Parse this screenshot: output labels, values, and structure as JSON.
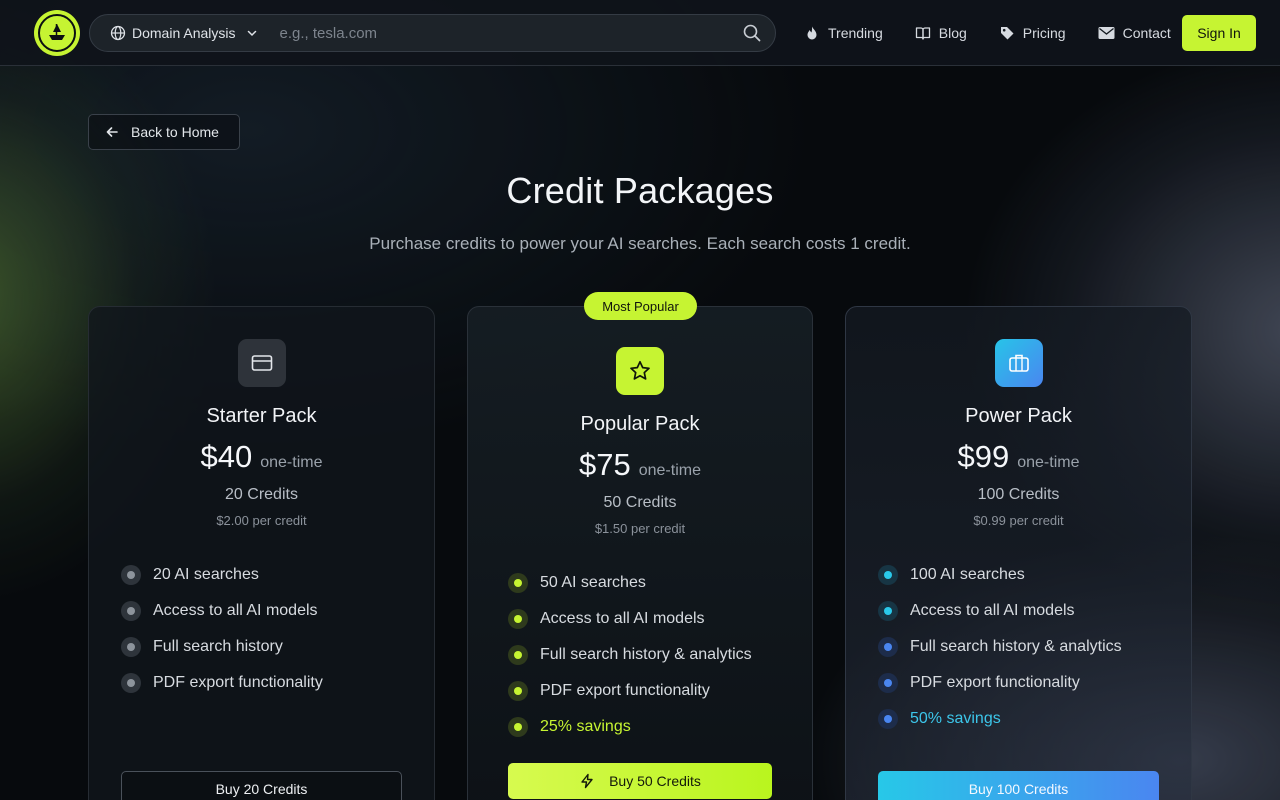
{
  "nav": {
    "search_mode": "Domain Analysis",
    "search_placeholder": "e.g., tesla.com",
    "links": [
      {
        "label": "Trending",
        "icon": "flame-icon"
      },
      {
        "label": "Blog",
        "icon": "book-icon"
      },
      {
        "label": "Pricing",
        "icon": "tag-icon"
      },
      {
        "label": "Contact",
        "icon": "mail-icon"
      }
    ],
    "signin_label": "Sign In"
  },
  "back_label": "Back to Home",
  "title": "Credit Packages",
  "subtitle": "Purchase credits to power your AI searches. Each search costs 1 credit.",
  "cards": [
    {
      "name": "Starter Pack",
      "icon": "credit-card-icon",
      "price": "$40",
      "price_note": "one-time",
      "credits": "20 Credits",
      "per_credit": "$2.00 per credit",
      "features": [
        "20 AI searches",
        "Access to all AI models",
        "Full search history",
        "PDF export functionality"
      ],
      "button": "Buy 20 Credits"
    },
    {
      "name": "Popular Pack",
      "badge": "Most Popular",
      "icon": "star-icon",
      "price": "$75",
      "price_note": "one-time",
      "credits": "50 Credits",
      "per_credit": "$1.50 per credit",
      "features": [
        "50 AI searches",
        "Access to all AI models",
        "Full search history & analytics",
        "PDF export functionality",
        "25% savings"
      ],
      "button": "Buy 50 Credits"
    },
    {
      "name": "Power Pack",
      "icon": "briefcase-icon",
      "price": "$99",
      "price_note": "one-time",
      "credits": "100 Credits",
      "per_credit": "$0.99 per credit",
      "features": [
        "100 AI searches",
        "Access to all AI models",
        "Full search history & analytics",
        "PDF export functionality",
        "50% savings"
      ],
      "button": "Buy 100 Credits"
    }
  ],
  "colors": {
    "accent_lime": "#c6f432",
    "accent_cyan": "#27c8e8",
    "accent_blue": "#4a86f0",
    "background": "#070a0d"
  }
}
